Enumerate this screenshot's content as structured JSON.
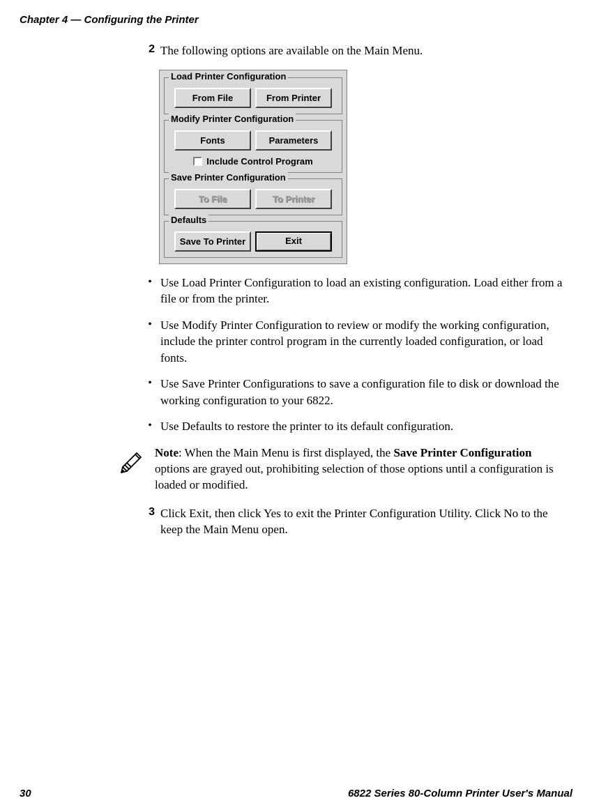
{
  "header": {
    "chapter": "Chapter 4 — Configuring the Printer"
  },
  "step2": {
    "num": "2",
    "text": "The following options are available on the Main Menu."
  },
  "dialog": {
    "group1": {
      "label": "Load Printer Configuration",
      "btn1": "From File",
      "btn2": "From Printer"
    },
    "group2": {
      "label": "Modify Printer Configuration",
      "btn1": "Fonts",
      "btn2": "Parameters",
      "checkbox": "Include Control Program"
    },
    "group3": {
      "label": "Save Printer Configuration",
      "btn1": "To File",
      "btn2": "To Printer"
    },
    "group4": {
      "label": "Defaults",
      "btn1": "Save To Printer",
      "btn2": "Exit"
    }
  },
  "bullets": {
    "b1": "Use Load Printer Configuration to load an existing configuration. Load either from a file or from the printer.",
    "b2": "Use Modify Printer Configuration to review or modify the working configuration, include the printer control program in the currently loaded configuration, or load fonts.",
    "b3": "Use Save Printer Configurations to save a configuration file to disk or download the working configuration to your 6822.",
    "b4": "Use Defaults to restore the printer to its default configuration."
  },
  "note": {
    "prefix": "Note",
    "part1": ": When the Main Menu is first displayed, the ",
    "bold1": "Save Printer Configuration",
    "part2": " options are grayed out, prohibiting selection of those options until a configuration is loaded or modified."
  },
  "step3": {
    "num": "3",
    "text": "Click Exit, then click Yes to exit the Printer Configuration Utility. Click No to the keep the Main Menu open."
  },
  "footer": {
    "pagenum": "30",
    "title": "6822 Series 80-Column Printer User's Manual"
  }
}
